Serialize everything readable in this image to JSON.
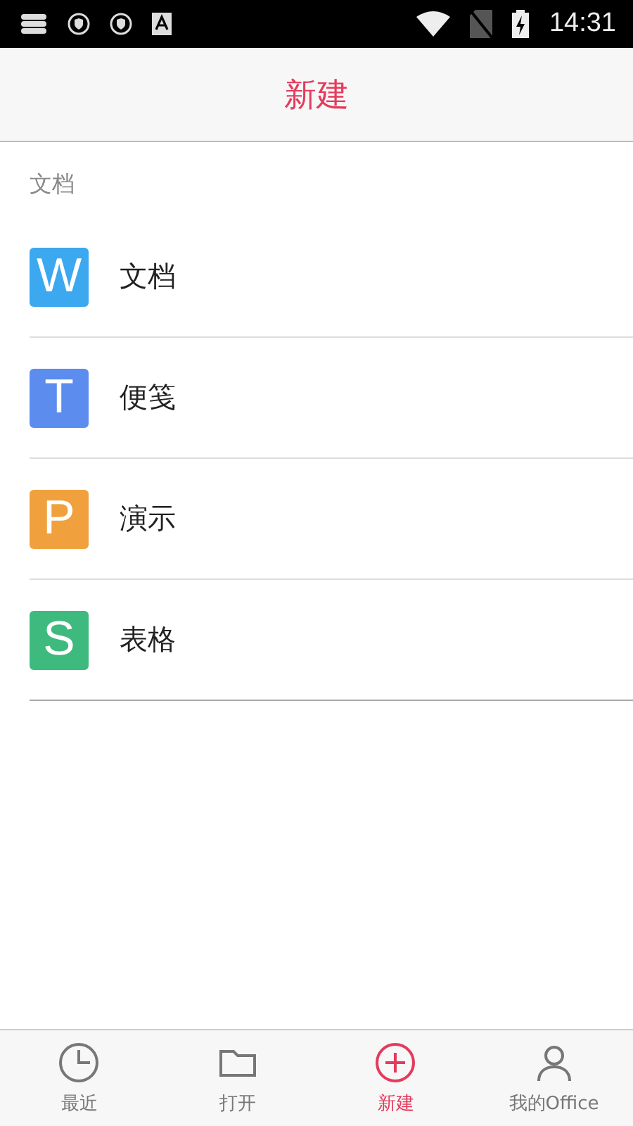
{
  "status_bar": {
    "time": "14:31"
  },
  "header": {
    "title": "新建"
  },
  "section": {
    "label": "文档"
  },
  "items": [
    {
      "glyph": "W",
      "label": "文档",
      "color": "#3ba8ef"
    },
    {
      "glyph": "T",
      "label": "便笺",
      "color": "#5b8cee"
    },
    {
      "glyph": "P",
      "label": "演示",
      "color": "#f0a13d"
    },
    {
      "glyph": "S",
      "label": "表格",
      "color": "#3fba7e"
    }
  ],
  "tabs": [
    {
      "kind": "recent",
      "label": "最近",
      "selected": false
    },
    {
      "kind": "open",
      "label": "打开",
      "selected": false
    },
    {
      "kind": "new",
      "label": "新建",
      "selected": true
    },
    {
      "kind": "mine",
      "label": "我的Office",
      "selected": false
    }
  ]
}
